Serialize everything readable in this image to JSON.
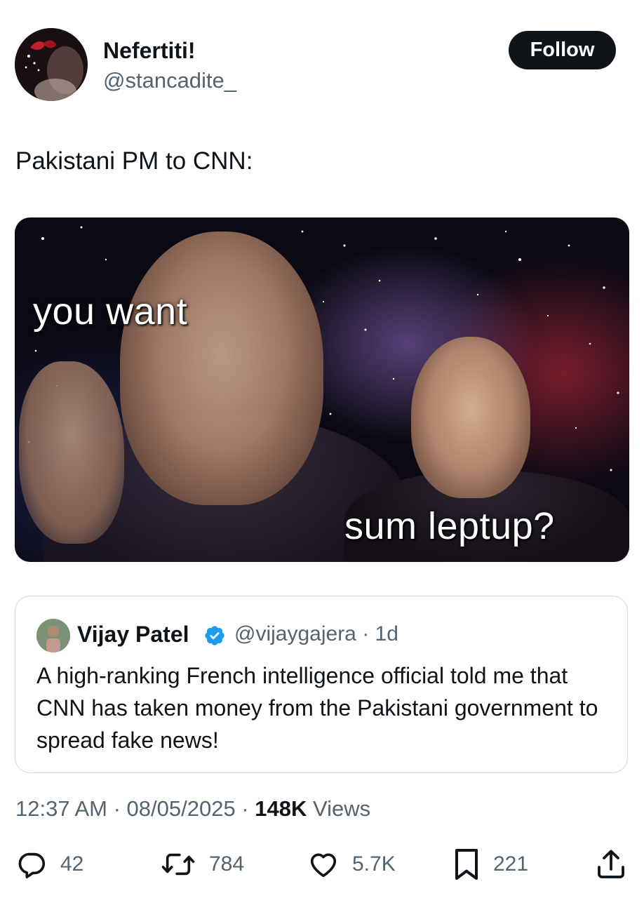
{
  "author": {
    "display_name": "Nefertiti!",
    "handle": "@stancadite_",
    "avatar_icon": "avatar-image"
  },
  "follow_label": "Follow",
  "tweet_text": "Pakistani PM to CNN:",
  "media": {
    "top_caption": "you want",
    "bottom_caption": "sum leptup?"
  },
  "quoted": {
    "display_name": "Vijay Patel",
    "verified": true,
    "handle_time": "@vijaygajera · 1d",
    "text": "A high-ranking French intelligence official told me that CNN has taken money from the Pakistani government to spread fake news!"
  },
  "meta": {
    "time_date": "12:37 AM · 08/05/2025 · ",
    "views_count": "148K",
    "views_label": " Views"
  },
  "actions": {
    "replies": "42",
    "reposts": "784",
    "likes": "5.7K",
    "bookmarks": "221"
  },
  "colors": {
    "text_primary": "#0f1419",
    "text_secondary": "#536471",
    "verified_blue": "#1d9bf0",
    "border": "#cfd9de"
  }
}
